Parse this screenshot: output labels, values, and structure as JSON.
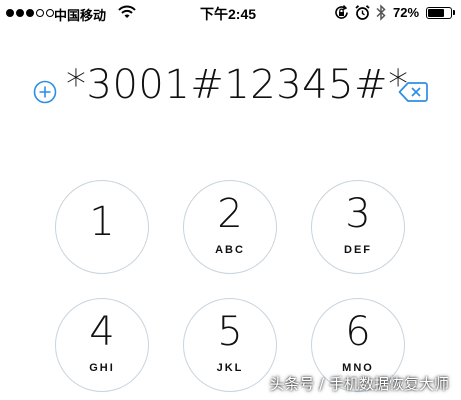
{
  "status_bar": {
    "carrier": "中国移动",
    "time": "下午2:45",
    "battery_percent": "72%",
    "battery_level": 0.72,
    "signal_strength": 3,
    "signal_max": 5
  },
  "dialer": {
    "number": "*3001#12345#*"
  },
  "keypad": {
    "keys": [
      {
        "digit": "1",
        "letters": ""
      },
      {
        "digit": "2",
        "letters": "ABC"
      },
      {
        "digit": "3",
        "letters": "DEF"
      },
      {
        "digit": "4",
        "letters": "GHI"
      },
      {
        "digit": "5",
        "letters": "JKL"
      },
      {
        "digit": "6",
        "letters": "MNO"
      }
    ]
  },
  "watermark": "头条号 / 手机数据恢复大师",
  "colors": {
    "accent": "#2e8de6",
    "key_border": "#c9d4dc",
    "background": "#ffffff"
  },
  "icons": [
    "wifi-icon",
    "orientation-lock-icon",
    "alarm-clock-icon",
    "bluetooth-icon",
    "battery-icon",
    "add-contact-icon",
    "delete-icon"
  ]
}
